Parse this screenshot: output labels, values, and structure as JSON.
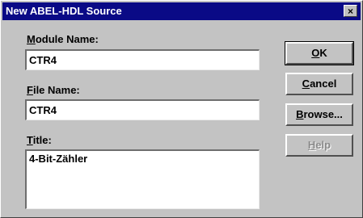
{
  "window": {
    "title": "New ABEL-HDL Source",
    "close_glyph": "×"
  },
  "fields": {
    "module_name": {
      "label_u": "M",
      "label_rest": "odule Name:",
      "value": "CTR4"
    },
    "file_name": {
      "label_u": "F",
      "label_rest": "ile Name:",
      "value": "CTR4"
    },
    "title": {
      "label_u": "T",
      "label_rest": "itle:",
      "value": "4-Bit-Zähler"
    }
  },
  "buttons": {
    "ok": {
      "u": "O",
      "rest": "K"
    },
    "cancel": {
      "u": "C",
      "rest": "ancel"
    },
    "browse": {
      "u": "B",
      "rest": "rowse..."
    },
    "help": {
      "u": "H",
      "rest": "elp"
    }
  }
}
